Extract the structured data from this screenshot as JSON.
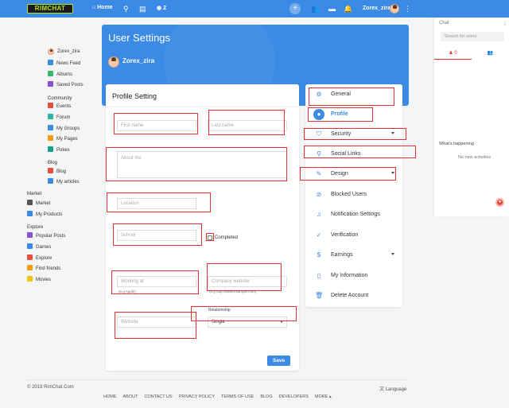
{
  "brand": {
    "logo": "RIMCHAT"
  },
  "topbar": {
    "home_label": "Home",
    "notif_count": "2",
    "user_name": "Zorex_zira",
    "icons": [
      "home-icon",
      "search-icon",
      "newspaper-icon",
      "eye-icon",
      "plus-icon",
      "people-icon",
      "chat-icon",
      "bell-icon",
      "more-icon"
    ]
  },
  "sidebar": {
    "user": "Zorex_zira",
    "items_top": [
      "News Feed",
      "Albums",
      "Saved Posts"
    ],
    "community_title": "Community",
    "community": [
      "Events",
      "Forum",
      "My Groups",
      "My Pages",
      "Pokes"
    ],
    "blog_title": "Blog",
    "blog": [
      "Blog",
      "My articles"
    ],
    "market_title": "Market",
    "market": [
      "Market",
      "My Products"
    ],
    "explore_title": "Explore",
    "explore": [
      "Popular Posts",
      "Games",
      "Explore",
      "Find friends",
      "Movies"
    ]
  },
  "banner": {
    "title": "User Settings",
    "user": "Zorex_zira"
  },
  "profile": {
    "title": "Profile Setting",
    "first_name_ph": "First name",
    "last_name_ph": "Last name",
    "about_ph": "About me",
    "location_ph": "Location",
    "school_ph": "School",
    "completed_label": "Completed",
    "working_ph": "Working at",
    "working_hint": "(e.g Apple)",
    "website_ph": "Company website",
    "website_hint": "(e.g http://www.example.com)",
    "relationship_label": "Relationship",
    "relationship_value": "Single",
    "website2_ph": "Website",
    "save_label": "Save"
  },
  "settings_menu": [
    {
      "label": "General",
      "icon": "gear-icon",
      "active": false,
      "caret": false
    },
    {
      "label": "Profile",
      "icon": "user-icon",
      "active": true,
      "caret": false
    },
    {
      "label": "Security",
      "icon": "shield-icon",
      "active": false,
      "caret": true
    },
    {
      "label": "Social Links",
      "icon": "link-icon",
      "active": false,
      "caret": false
    },
    {
      "label": "Design",
      "icon": "brush-icon",
      "active": false,
      "caret": true
    },
    {
      "label": "Blocked Users",
      "icon": "block-icon",
      "active": false,
      "caret": false
    },
    {
      "label": "Notification Settings",
      "icon": "bell-icon",
      "active": false,
      "caret": false
    },
    {
      "label": "Verification",
      "icon": "check-circle-icon",
      "active": false,
      "caret": false
    },
    {
      "label": "Earnings",
      "icon": "dollar-icon",
      "active": false,
      "caret": true
    },
    {
      "label": "My Information",
      "icon": "document-icon",
      "active": false,
      "caret": false
    },
    {
      "label": "Delete Account",
      "icon": "trash-icon",
      "active": false,
      "caret": false
    }
  ],
  "chat": {
    "title": "Chat",
    "search_ph": "Search for users",
    "online_count": "0",
    "happening_title": "What's happening",
    "no_activities": "No new activities"
  },
  "footer": {
    "copyright": "© 2019 RimChat.Com",
    "language": "Language",
    "links": [
      "HOME",
      "ABOUT",
      "CONTACT US",
      "PRIVACY POLICY",
      "TERMS OF USE",
      "BLOG",
      "DEVELOPERS",
      "MORE ▴"
    ]
  },
  "colors": {
    "accent": "#3a8ae6",
    "annotation": "#e0332f"
  }
}
